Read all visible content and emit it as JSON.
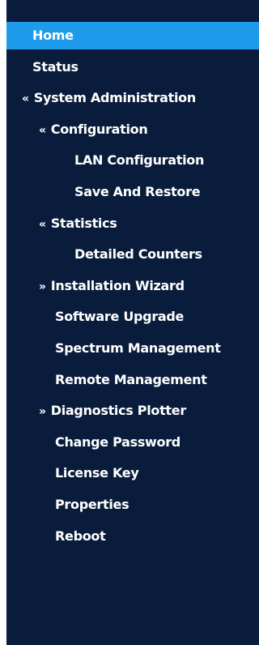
{
  "sidebar": {
    "items": [
      {
        "label": "Home",
        "marker": ""
      },
      {
        "label": "Status",
        "marker": ""
      },
      {
        "label": "System Administration",
        "marker": "«"
      },
      {
        "label": "Configuration",
        "marker": "«"
      },
      {
        "label": "LAN Configuration",
        "marker": ""
      },
      {
        "label": "Save And Restore",
        "marker": ""
      },
      {
        "label": "Statistics",
        "marker": "«"
      },
      {
        "label": "Detailed Counters",
        "marker": ""
      },
      {
        "label": "Installation Wizard",
        "marker": "»"
      },
      {
        "label": "Software Upgrade",
        "marker": ""
      },
      {
        "label": "Spectrum Management",
        "marker": ""
      },
      {
        "label": "Remote Management",
        "marker": ""
      },
      {
        "label": "Diagnostics Plotter",
        "marker": "»"
      },
      {
        "label": "Change Password",
        "marker": ""
      },
      {
        "label": "License Key",
        "marker": ""
      },
      {
        "label": "Properties",
        "marker": ""
      },
      {
        "label": "Reboot",
        "marker": ""
      }
    ]
  },
  "colors": {
    "sidebar_bg": "#0a1c3c",
    "active_bg": "#1e9bea",
    "text": "#ffffff"
  }
}
